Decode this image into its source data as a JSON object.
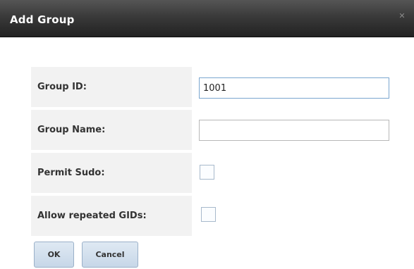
{
  "dialog": {
    "title": "Add Group",
    "close_icon": "close-icon"
  },
  "fields": {
    "group_id": {
      "label": "Group ID:",
      "value": "1001"
    },
    "group_name": {
      "label": "Group Name:",
      "value": ""
    },
    "permit_sudo": {
      "label": "Permit Sudo:",
      "checked": false
    },
    "allow_repeated_gids": {
      "label": "Allow repeated GIDs:",
      "checked": false
    }
  },
  "buttons": {
    "ok": "OK",
    "cancel": "Cancel"
  }
}
